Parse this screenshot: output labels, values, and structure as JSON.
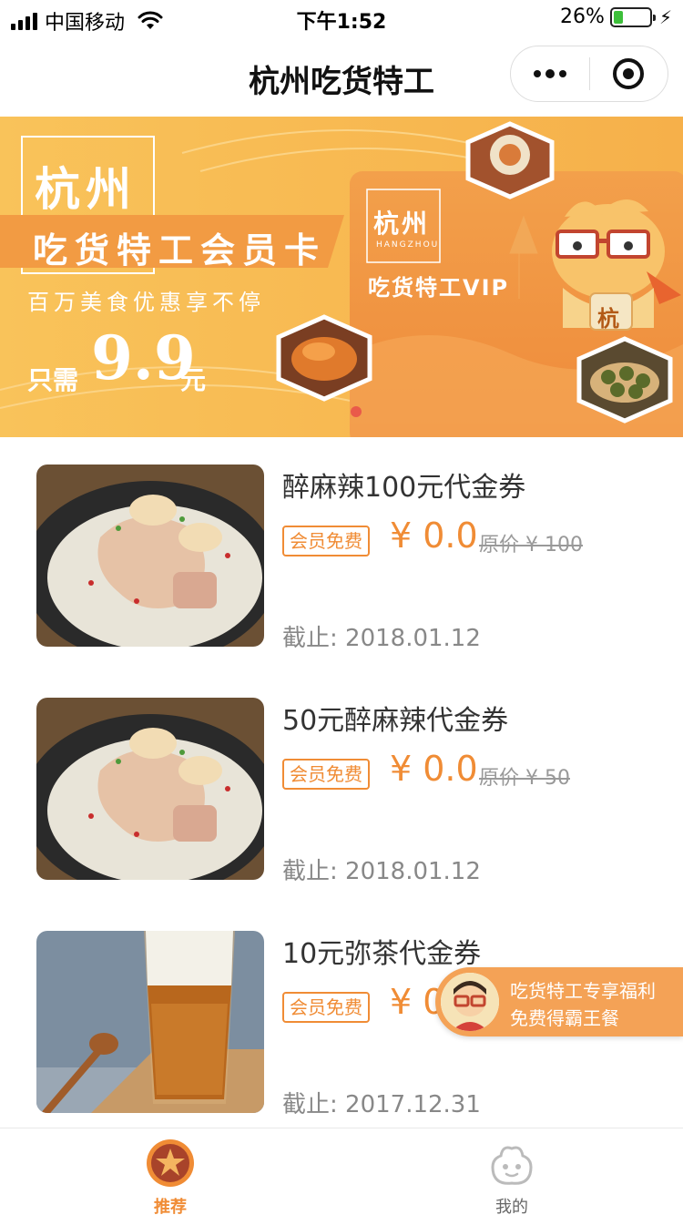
{
  "status_bar": {
    "carrier": "中国移动",
    "time": "下午1:52",
    "battery": "26%",
    "battery_level": 0.26
  },
  "nav": {
    "title": "杭州吃货特工"
  },
  "banner": {
    "city": "杭州",
    "card_title": "吃货特工会员卡",
    "subtitle": "百万美食优惠享不停",
    "price_prefix": "只需",
    "price": "9.9",
    "price_unit": "元",
    "vip_city": "杭州",
    "vip_city_en": "HANGZHOU",
    "vip_label": "吃货特工VIP",
    "mascot_char": "杭"
  },
  "coupons": [
    {
      "title": "醉麻辣100元代金券",
      "badge": "会员免费",
      "price": "¥ 0.0",
      "original": "原价 ¥ 100",
      "deadline": "截止: 2018.01.12",
      "image": "pork-trotter-soup"
    },
    {
      "title": "50元醉麻辣代金券",
      "badge": "会员免费",
      "price": "¥ 0.0",
      "original": "原价 ¥ 50",
      "deadline": "截止: 2018.01.12",
      "image": "pork-trotter-soup"
    },
    {
      "title": "10元弥茶代金券",
      "badge": "会员免费",
      "price": "¥ 0",
      "deadline": "截止: 2017.12.31",
      "image": "milk-tea"
    }
  ],
  "float_promo": {
    "line1": "吃货特工专享福利",
    "line2": "免费得霸王餐"
  },
  "tabs": [
    {
      "label": "推荐",
      "icon": "recommend-icon",
      "active": true
    },
    {
      "label": "我的",
      "icon": "profile-icon",
      "active": false
    }
  ],
  "colors": {
    "accent": "#f08c35",
    "banner_bg": "#f7b94f",
    "promo_bg": "#f4a256"
  }
}
